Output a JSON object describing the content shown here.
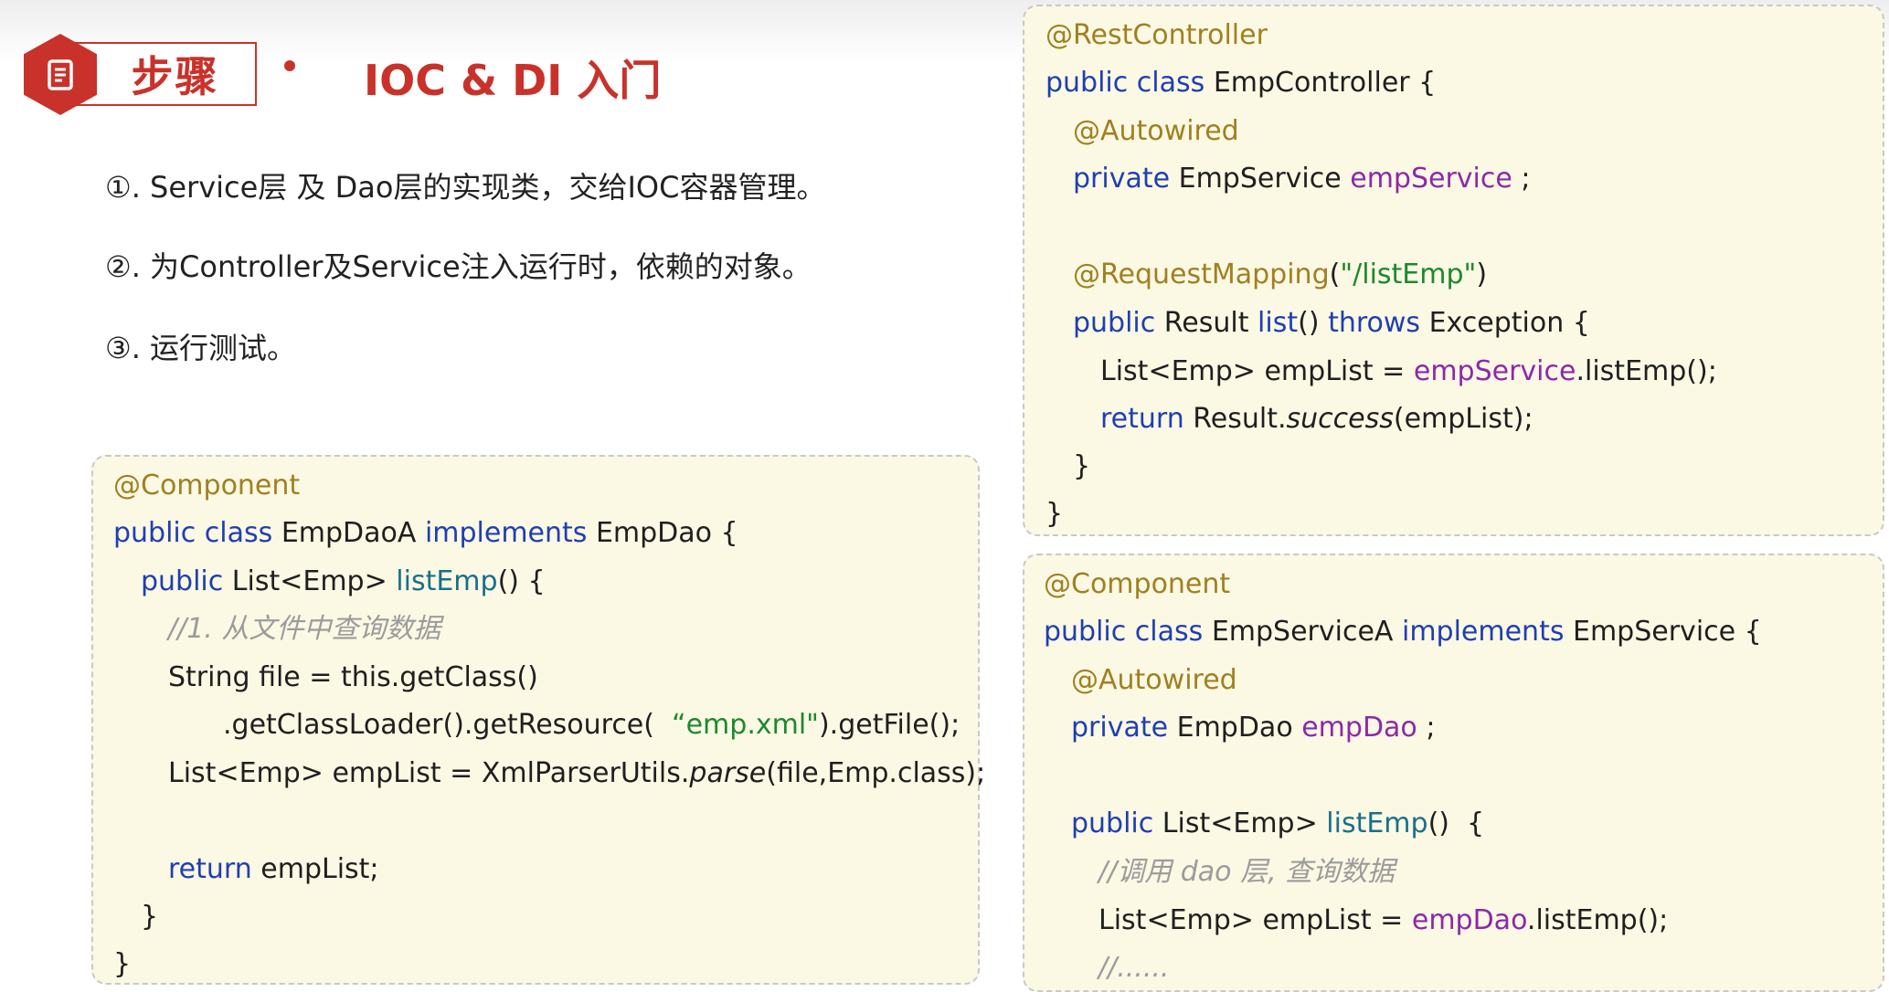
{
  "header": {
    "tag_label": "步骤",
    "title": "IOC & DI 入门"
  },
  "steps": [
    "①. Service层 及 Dao层的实现类，交给IOC容器管理。",
    "②. 为Controller及Service注入运行时，依赖的对象。",
    "③. 运行测试。"
  ],
  "dao_code": {
    "l1_an": "@Component",
    "l2_kw": "public class",
    "l2_name": " EmpDaoA ",
    "l2_kw2": "implements",
    "l2_rest": " EmpDao {",
    "l3_kw": "public",
    "l3_type": " List<Emp> ",
    "l3_m": "listEmp",
    "l3_rest": "() {",
    "l4_cm": "//1. 从文件中查询数据",
    "l5": "String file = this.getClass()",
    "l6_a": ".getClassLoader().getResource(  ",
    "l6_str": "“emp.xml\"",
    "l6_b": ").getFile();",
    "l7_a": "List<Emp> empList = XmlParserUtils.",
    "l7_it": "parse",
    "l7_b": "(file,Emp.class);",
    "l9_kw": "return",
    "l9_rest": " empList;",
    "l10": "}",
    "l11": "}"
  },
  "controller_code": {
    "l1_an": "@RestController",
    "l2_kw": "public class",
    "l2_rest": " EmpController {",
    "l3_an": "@Autowired",
    "l4_kw": "private",
    "l4_type": " EmpService ",
    "l4_f": "empService",
    "l4_rest": " ;",
    "l6_an": "@RequestMapping",
    "l6_a": "(",
    "l6_str": "\"/listEmp\"",
    "l6_b": ")",
    "l7_kw": "public",
    "l7_type": " Result ",
    "l7_m": "list",
    "l7_mid": "() ",
    "l7_kw2": "throws",
    "l7_rest": " Exception {",
    "l8_a": "List<Emp> empList = ",
    "l8_f": "empService",
    "l8_b": ".listEmp();",
    "l9_kw": "return",
    "l9_a": " Result.",
    "l9_it": "success",
    "l9_b": "(empList);",
    "l10": "}",
    "l11": "}"
  },
  "service_code": {
    "l1_an": "@Component",
    "l2_kw": "public class",
    "l2_name": " EmpServiceA ",
    "l2_kw2": "implements",
    "l2_rest": " EmpService {",
    "l3_an": "@Autowired",
    "l4_kw": "private",
    "l4_type": " EmpDao ",
    "l4_f": "empDao",
    "l4_rest": " ;",
    "l6_kw": "public",
    "l6_type": " List<Emp> ",
    "l6_m": "listEmp",
    "l6_rest": "()  {",
    "l7_cm": "//调用 dao 层, 查询数据",
    "l8_a": "List<Emp> empList = ",
    "l8_f": "empDao",
    "l8_b": ".listEmp();",
    "l9_cm": "//......"
  }
}
